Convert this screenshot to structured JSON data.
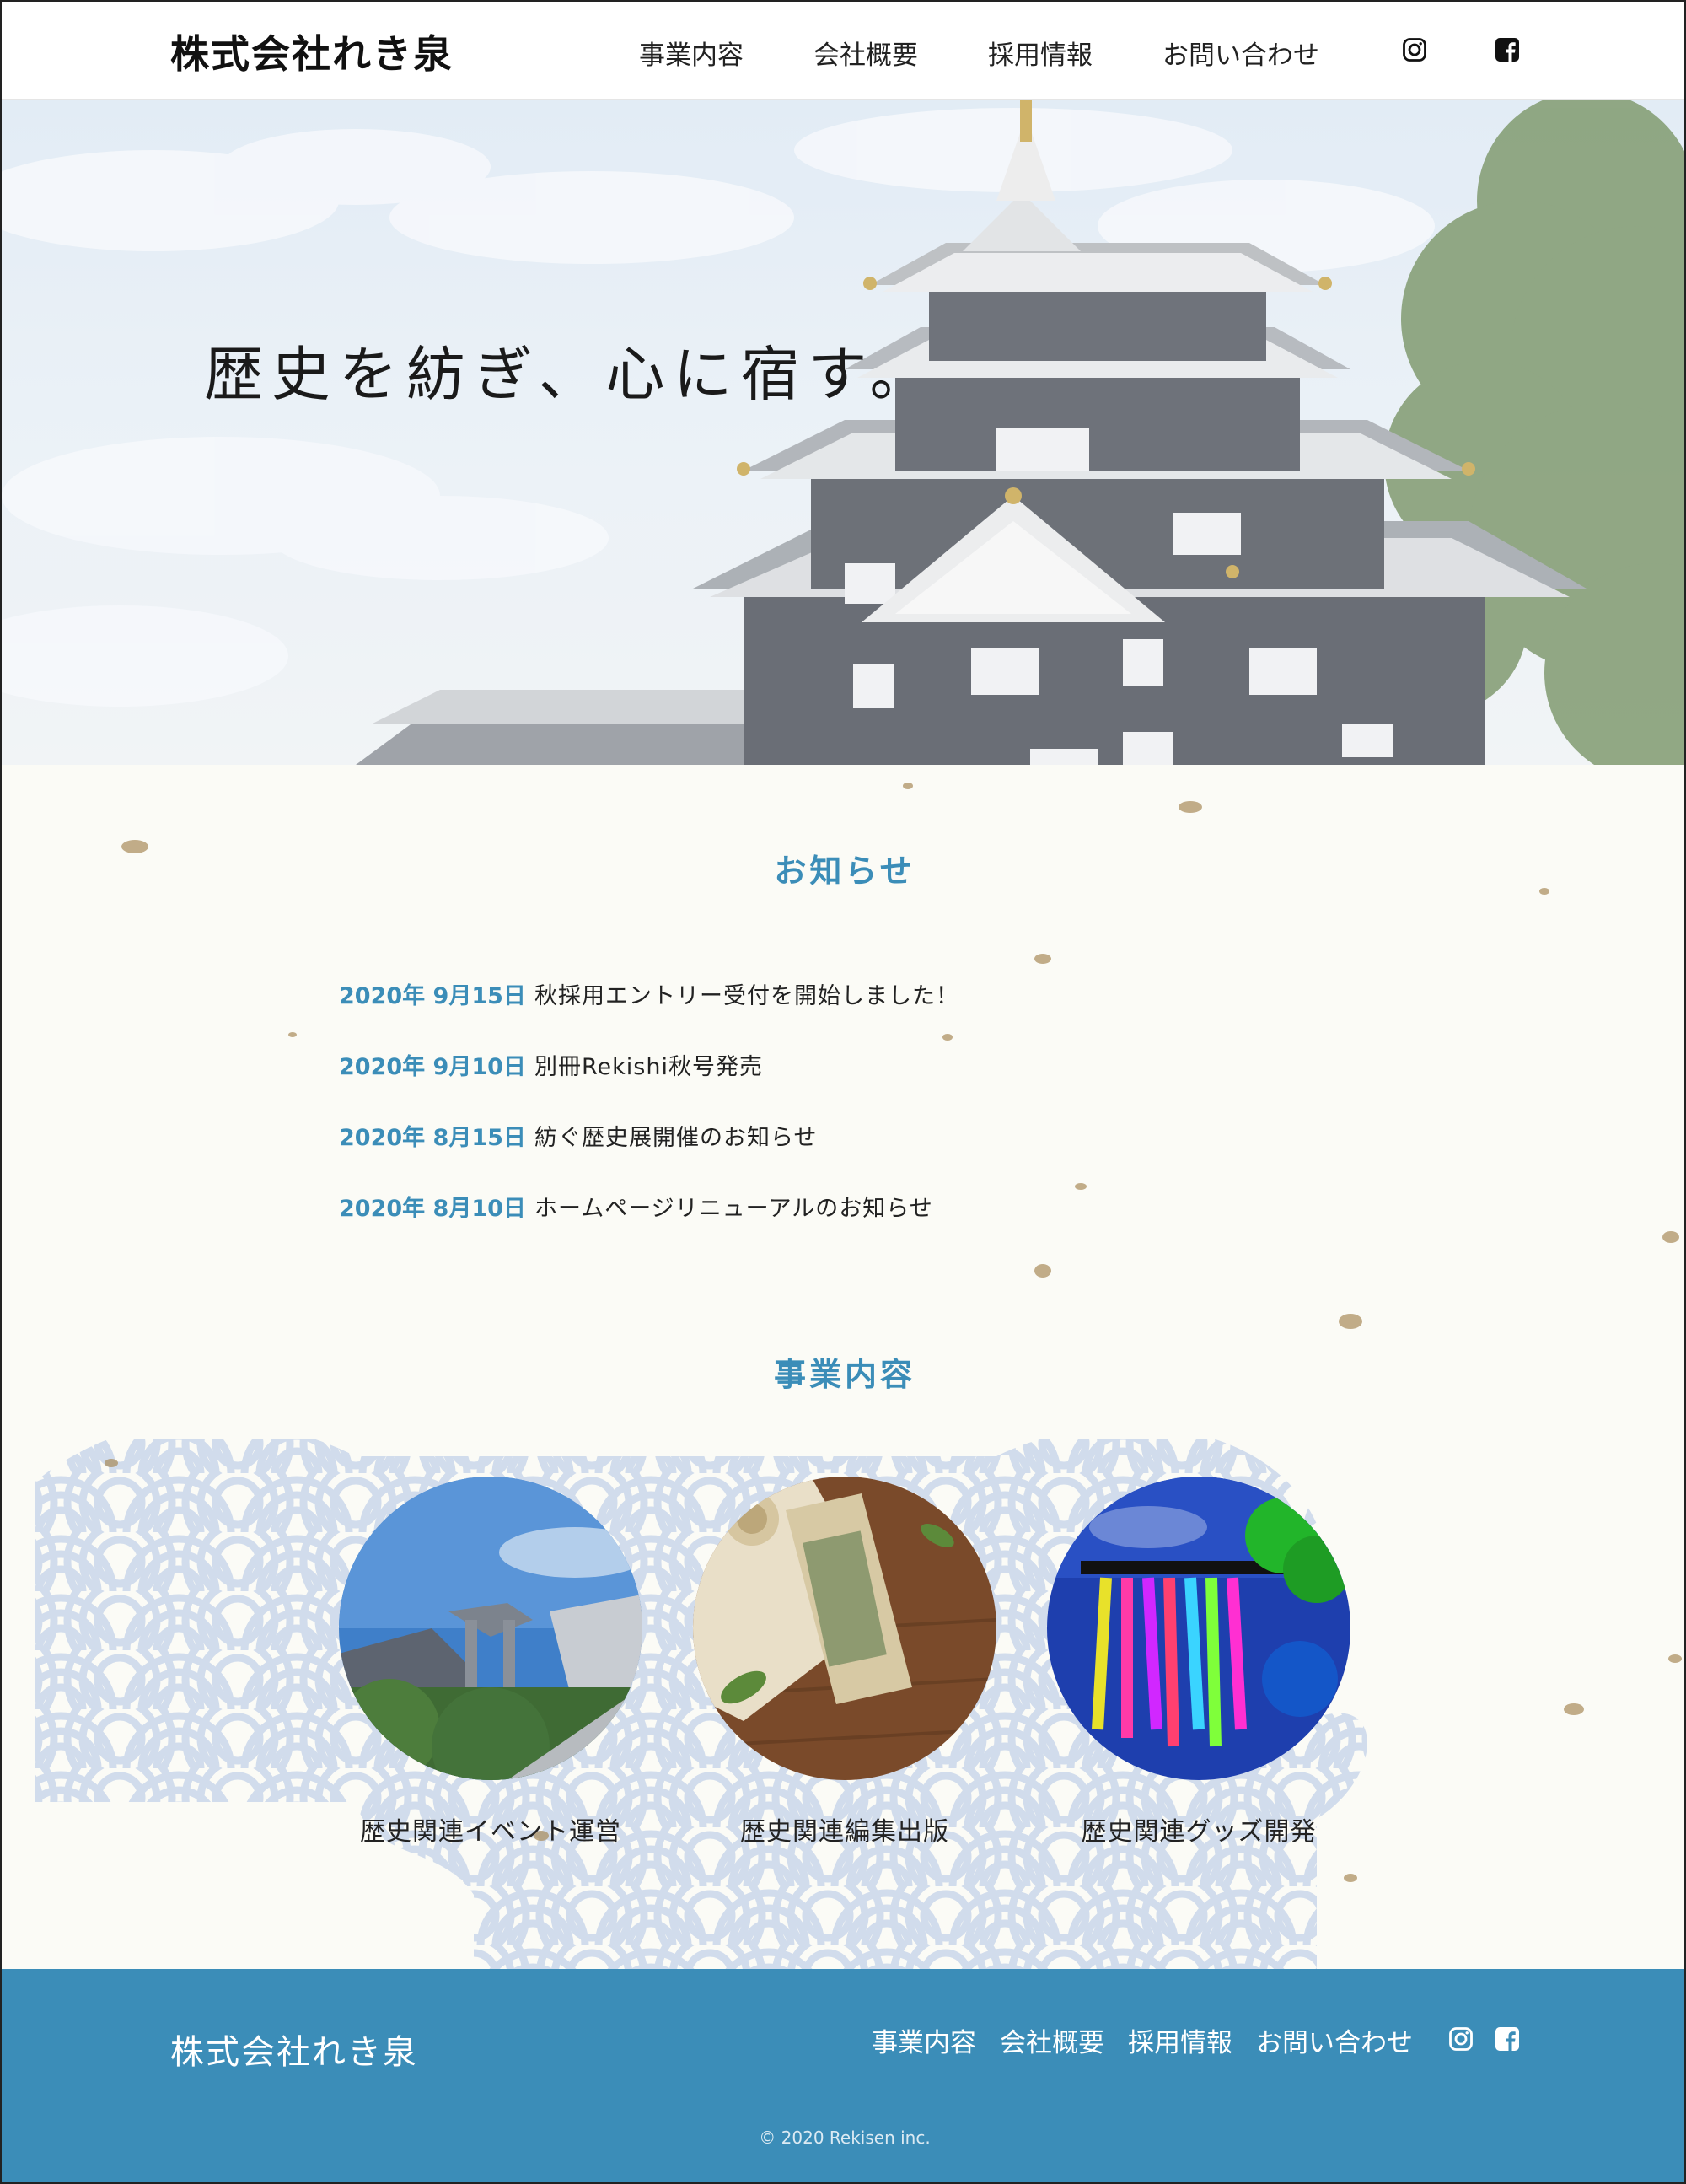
{
  "header": {
    "logo": "株式会社れき泉",
    "nav": [
      "事業内容",
      "会社概要",
      "採用情報",
      "お問い合わせ"
    ],
    "icons": [
      "instagram-icon",
      "facebook-icon"
    ]
  },
  "hero": {
    "catchcopy": "歴史を紡ぎ、心に宿す。"
  },
  "news": {
    "title": "お知らせ",
    "items": [
      {
        "date": "2020年 9月15日",
        "text": "秋採用エントリー受付を開始しました！"
      },
      {
        "date": "2020年 9月10日",
        "text": "別冊Rekishi秋号発売"
      },
      {
        "date": "2020年 8月15日",
        "text": "紡ぐ歴史展開催のお知らせ"
      },
      {
        "date": "2020年 8月10日",
        "text": "ホームページリニューアルのお知らせ"
      }
    ]
  },
  "business": {
    "title": "事業内容",
    "items": [
      {
        "label": "歴史関連イベント運営"
      },
      {
        "label": "歴史関連編集出版"
      },
      {
        "label": "歴史関連グッズ開発"
      }
    ]
  },
  "footer": {
    "logo": "株式会社れき泉",
    "nav": [
      "事業内容",
      "会社概要",
      "採用情報",
      "お問い合わせ"
    ],
    "copyright": "© 2020 Rekisen inc."
  },
  "colors": {
    "accent": "#3b8db8",
    "footer_bg": "#3b8db8",
    "paper_bg": "#fbfbf6",
    "wave_pattern": "#c9d6ea"
  }
}
